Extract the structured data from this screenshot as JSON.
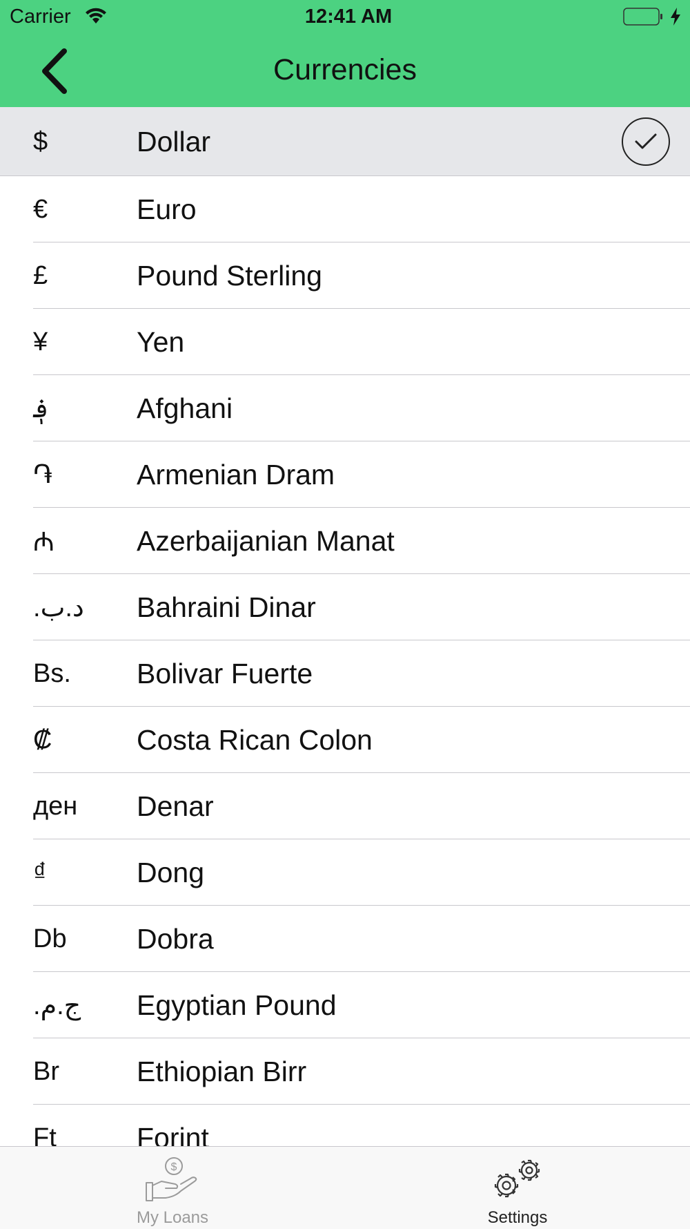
{
  "status_bar": {
    "carrier": "Carrier",
    "time": "12:41 AM",
    "battery_color": "#4cd281"
  },
  "nav": {
    "title": "Currencies",
    "back_icon": "chevron-left-icon"
  },
  "currencies": [
    {
      "symbol": "$",
      "name": "Dollar",
      "selected": true
    },
    {
      "symbol": "€",
      "name": "Euro"
    },
    {
      "symbol": "£",
      "name": "Pound Sterling"
    },
    {
      "symbol": "¥",
      "name": "Yen"
    },
    {
      "symbol": "؋",
      "name": "Afghani"
    },
    {
      "symbol": "֏",
      "name": "Armenian Dram"
    },
    {
      "symbol": "₼",
      "name": "Azerbaijanian Manat"
    },
    {
      "symbol": ".د.ب",
      "name": "Bahraini Dinar"
    },
    {
      "symbol": "Bs.",
      "name": "Bolivar Fuerte"
    },
    {
      "symbol": "₡",
      "name": "Costa Rican Colon"
    },
    {
      "symbol": "ден",
      "name": "Denar"
    },
    {
      "symbol": "₫",
      "name": "Dong"
    },
    {
      "symbol": "Db",
      "name": "Dobra"
    },
    {
      "symbol": ".ج.م",
      "name": "Egyptian Pound"
    },
    {
      "symbol": "Br",
      "name": "Ethiopian Birr"
    },
    {
      "symbol": "Ft",
      "name": "Forint"
    }
  ],
  "tabbar": {
    "tabs": [
      {
        "label": "My Loans",
        "icon": "hand-money-icon",
        "active": false
      },
      {
        "label": "Settings",
        "icon": "gears-icon",
        "active": true
      }
    ]
  },
  "colors": {
    "header": "#4cd281",
    "selected_row": "#e6e7ea",
    "separator": "#c8c7cc",
    "tab_inactive": "#9b9b9b"
  }
}
